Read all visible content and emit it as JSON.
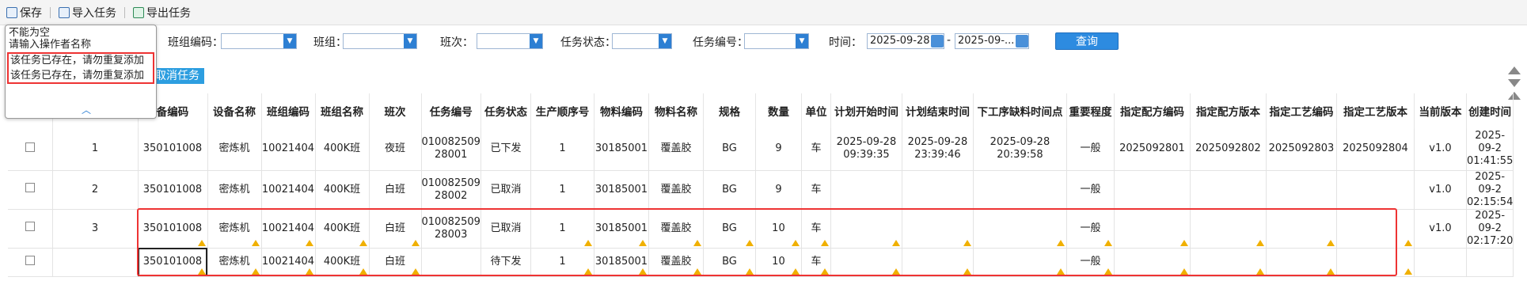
{
  "toolbar": {
    "save": "保存",
    "import": "导入任务",
    "export": "导出任务"
  },
  "filters": {
    "team_code_label": "班组编码：",
    "team_label": "班组：",
    "shift_label": "班次：",
    "status_label": "任务状态：",
    "task_no_label": "任务编号：",
    "time_label": "时间：",
    "date_from": "2025-09-28",
    "date_sep": "-",
    "date_to": "2025-09-...",
    "query": "查询"
  },
  "tooltip": {
    "line1": "不能为空",
    "line2": "请输入操作者名称",
    "line3": "该任务已存在，请勿重复添加",
    "line4": "该任务已存在，请勿重复添加"
  },
  "cancel_task": "取消任务",
  "headers": [
    "",
    "",
    "备编码",
    "设备名称",
    "班组编码",
    "班组名称",
    "班次",
    "任务编号",
    "任务状态",
    "生产顺序号",
    "物料编码",
    "物料名称",
    "规格",
    "数量",
    "单位",
    "计划开始时间",
    "计划结束时间",
    "下工序缺料时间点",
    "重要程度",
    "指定配方编码",
    "指定配方版本",
    "指定工艺编码",
    "指定工艺版本",
    "当前版本",
    "创建时间"
  ],
  "rows": [
    [
      "",
      "1",
      "350101008",
      "密炼机",
      "10021404",
      "400K班",
      "夜班",
      "010082509 28001",
      "已下发",
      "1",
      "30185001",
      "覆盖胶",
      "BG",
      "9",
      "车",
      "2025-09-28 09:39:35",
      "2025-09-28 23:39:46",
      "2025-09-28 20:39:58",
      "一般",
      "2025092801",
      "2025092802",
      "2025092803",
      "2025092804",
      "v1.0",
      "2025-09-2 01:41:55"
    ],
    [
      "",
      "2",
      "350101008",
      "密炼机",
      "10021404",
      "400K班",
      "白班",
      "010082509 28002",
      "已取消",
      "1",
      "30185001",
      "覆盖胶",
      "BG",
      "9",
      "车",
      "",
      "",
      "",
      "一般",
      "",
      "",
      "",
      "",
      "v1.0",
      "2025-09-2 02:15:54"
    ],
    [
      "",
      "3",
      "350101008",
      "密炼机",
      "10021404",
      "400K班",
      "白班",
      "010082509 28003",
      "已取消",
      "1",
      "30185001",
      "覆盖胶",
      "BG",
      "10",
      "车",
      "",
      "",
      "",
      "一般",
      "",
      "",
      "",
      "",
      "v1.0",
      "2025-09-2 02:17:20"
    ],
    [
      "",
      "",
      "350101008",
      "密炼机",
      "10021404",
      "400K班",
      "白班",
      "",
      "待下发",
      "1",
      "30185001",
      "覆盖胶",
      "BG",
      "10",
      "车",
      "",
      "",
      "",
      "一般",
      "",
      "",
      "",
      "",
      "",
      ""
    ]
  ]
}
